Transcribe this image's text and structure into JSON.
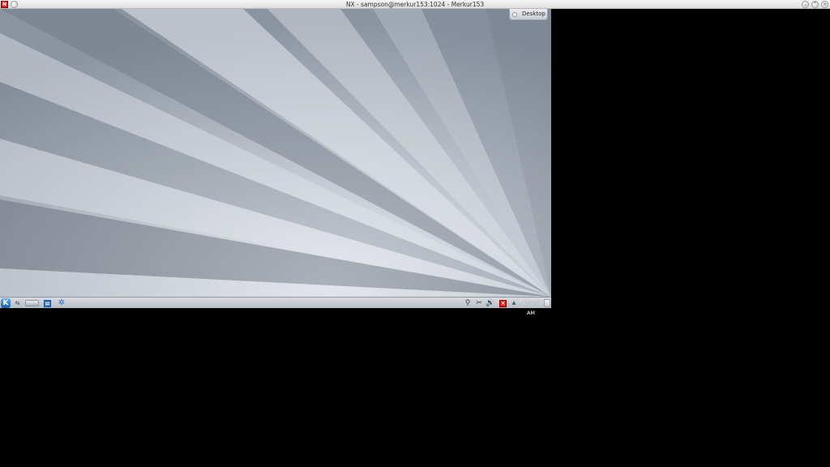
{
  "window": {
    "title": "NX - sampson@merkur153:1024 - Merkur153",
    "app_icon": "nx-app-icon",
    "controls": [
      "minimize-icon",
      "maximize-icon",
      "close-icon"
    ]
  },
  "desktop": {
    "toolbox_label": "Desktop",
    "toolbox_icon": "desktop-toolbox-icon"
  },
  "panel": {
    "launcher_icon": "kde-kickoff-icon",
    "pager_icon": "pager-icon",
    "taskbar_icon": "taskbar-window-icon",
    "list_icon": "task-list-icon",
    "update_icon": "update-notifier-icon",
    "tray_icons": [
      "network-icon",
      "clipboard-scissors-icon",
      "volume-icon",
      "nx-close-icon"
    ],
    "tray_arrow_icon": "show-hidden-icons-arrow",
    "clock": "10:26 AM",
    "cashew_icon": "panel-toolbox-icon"
  },
  "colors": {
    "panel_top": "#d8dbdf",
    "panel_bottom": "#b9bec5",
    "accent_blue": "#1d5fae",
    "close_red": "#e02020",
    "outside_bg": "#000000"
  }
}
